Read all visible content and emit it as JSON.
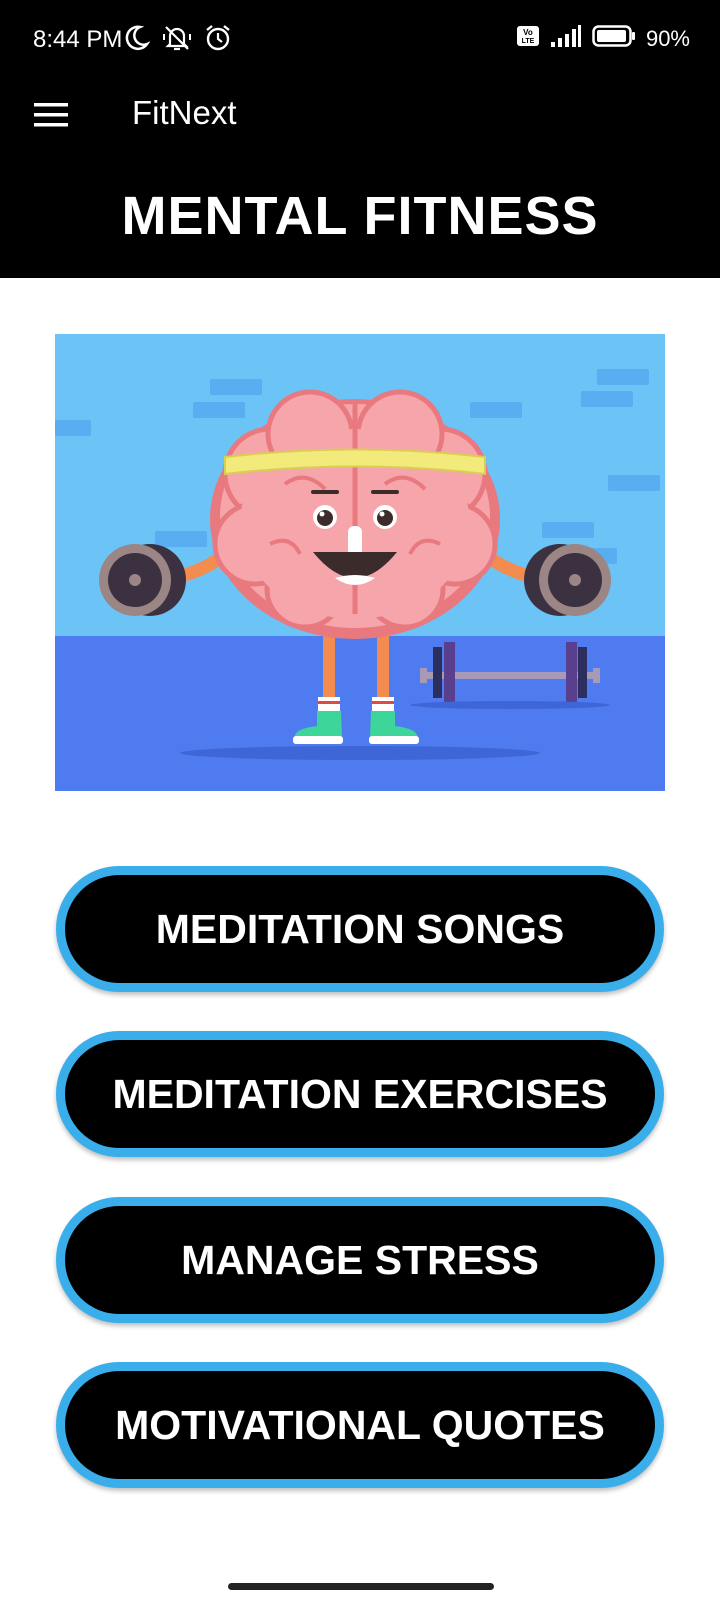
{
  "status_bar": {
    "time": "8:44 PM",
    "battery": "90%",
    "network": "VoLTE",
    "icons": [
      "moon-icon",
      "notifications-off-icon",
      "alarm-icon",
      "volte-icon",
      "signal-icon",
      "battery-icon"
    ]
  },
  "toolbar": {
    "title": "FitNext",
    "menu_icon": "hamburger-menu-icon"
  },
  "header": {
    "title": "MENTAL FITNESS"
  },
  "hero": {
    "illustration": "brain-lifting-dumbbells"
  },
  "buttons": [
    {
      "label": "MEDITATION SONGS"
    },
    {
      "label": "MEDITATION EXERCISES"
    },
    {
      "label": "MANAGE STRESS"
    },
    {
      "label": "MOTIVATIONAL QUOTES"
    }
  ],
  "colors": {
    "background": "#ffffff",
    "bar": "#000000",
    "button_border": "#3aaeea",
    "hero_sky": "#6cc3f6",
    "hero_floor": "#4f7bf0"
  }
}
